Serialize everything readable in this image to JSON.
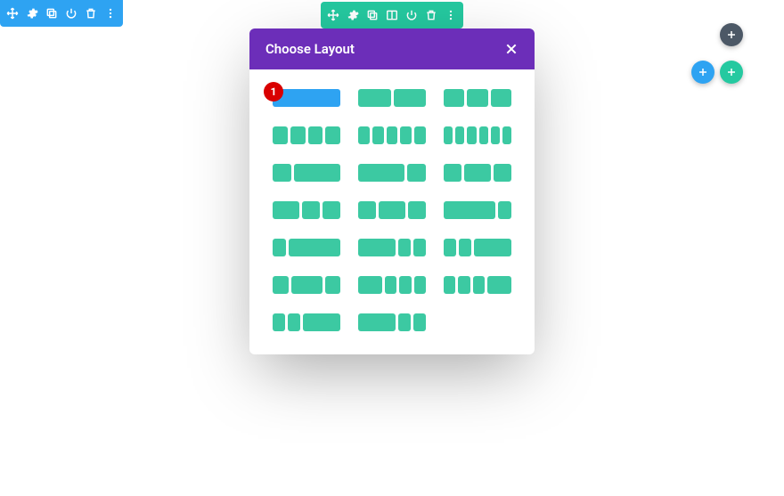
{
  "popup": {
    "title": "Choose Layout"
  },
  "step": {
    "number": "1"
  },
  "layouts": [
    {
      "cols": [
        1
      ],
      "selected": true
    },
    {
      "cols": [
        1,
        1
      ]
    },
    {
      "cols": [
        1,
        1,
        1
      ]
    },
    {
      "cols": [
        1,
        1,
        1,
        1
      ]
    },
    {
      "cols": [
        1,
        1,
        1,
        1,
        1
      ]
    },
    {
      "cols": [
        1,
        1,
        1,
        1,
        1,
        1
      ]
    },
    {
      "cols": [
        2,
        5
      ]
    },
    {
      "cols": [
        5,
        2
      ]
    },
    {
      "cols": [
        2,
        3,
        2
      ]
    },
    {
      "cols": [
        3,
        2,
        2
      ]
    },
    {
      "cols": [
        2,
        3,
        2
      ]
    },
    {
      "cols": [
        4,
        1
      ]
    },
    {
      "cols": [
        1,
        4
      ]
    },
    {
      "cols": [
        3,
        1,
        1
      ]
    },
    {
      "cols": [
        1,
        1,
        3
      ]
    },
    {
      "cols": [
        1,
        2,
        1
      ]
    },
    {
      "cols": [
        2,
        1,
        1,
        1
      ]
    },
    {
      "cols": [
        1,
        1,
        1,
        2
      ]
    },
    {
      "cols": [
        1,
        1,
        3
      ]
    },
    {
      "cols": [
        3,
        1,
        1
      ]
    }
  ]
}
